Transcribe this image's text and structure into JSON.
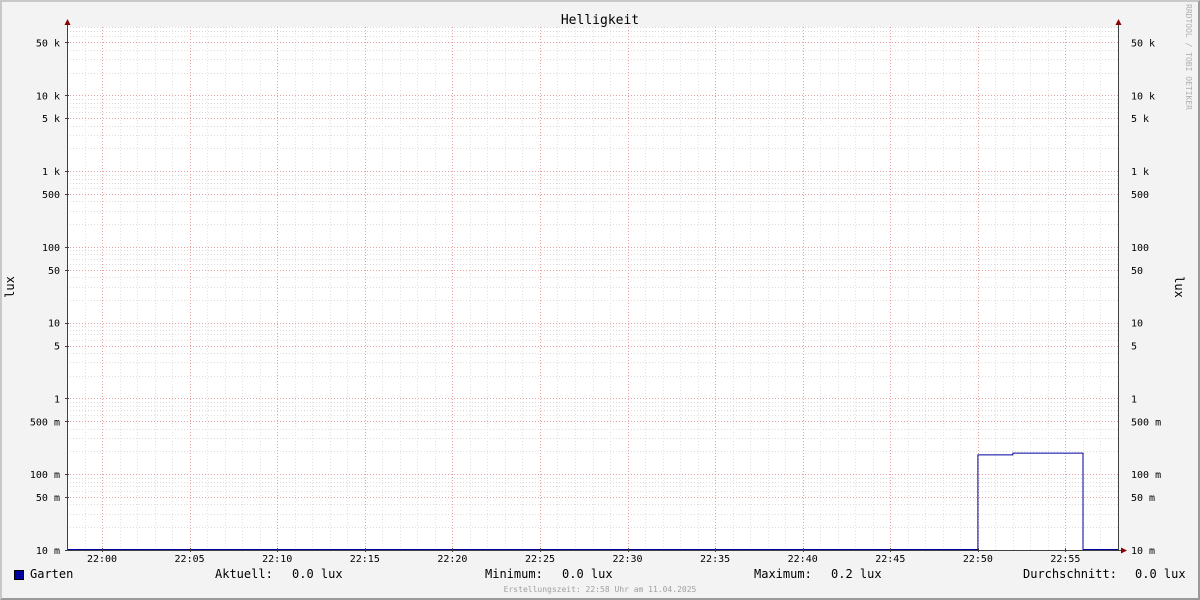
{
  "chart_data": {
    "type": "line",
    "title": "Helligkeit",
    "ylabel": "lux",
    "ylabel_right": "lux",
    "y_scale": "log",
    "ylim": [
      0.01,
      80000
    ],
    "y_ticks": [
      {
        "value": 50000,
        "label": "50 k"
      },
      {
        "value": 10000,
        "label": "10 k"
      },
      {
        "value": 5000,
        "label": "5 k"
      },
      {
        "value": 1000,
        "label": "1 k"
      },
      {
        "value": 500,
        "label": "500"
      },
      {
        "value": 100,
        "label": "100"
      },
      {
        "value": 50,
        "label": "50"
      },
      {
        "value": 10,
        "label": "10"
      },
      {
        "value": 5,
        "label": "5"
      },
      {
        "value": 1,
        "label": "1"
      },
      {
        "value": 0.5,
        "label": "500 m"
      },
      {
        "value": 0.1,
        "label": "100 m"
      },
      {
        "value": 0.05,
        "label": "50 m"
      },
      {
        "value": 0.01,
        "label": "10 m"
      }
    ],
    "x_ticks": [
      "22:00",
      "22:05",
      "22:10",
      "22:15",
      "22:20",
      "22:25",
      "22:30",
      "22:35",
      "22:40",
      "22:45",
      "22:50",
      "22:55"
    ],
    "xlim": [
      "21:58",
      "22:58"
    ],
    "series": [
      {
        "name": "Garten",
        "color": "#0000a0",
        "x": [
          "21:58",
          "22:50",
          "22:50",
          "22:52",
          "22:52",
          "22:56",
          "22:56",
          "22:58"
        ],
        "y": [
          0.01,
          0.01,
          0.18,
          0.18,
          0.19,
          0.19,
          0.01,
          0.01
        ]
      }
    ],
    "grid": true,
    "legend": "bottom-left"
  },
  "legend": {
    "name": "Garten",
    "current_label": "Aktuell:",
    "current_value": "0.0 lux",
    "min_label": "Minimum:",
    "min_value": "0.0 lux",
    "max_label": "Maximum:",
    "max_value": "0.2 lux",
    "avg_label": "Durchschnitt:",
    "avg_value": "0.0 lux"
  },
  "watermark": "RRDTOOL / TOBI OETIKER",
  "footer": "Erstellungszeit: 22:58 Uhr am 11.04.2025"
}
